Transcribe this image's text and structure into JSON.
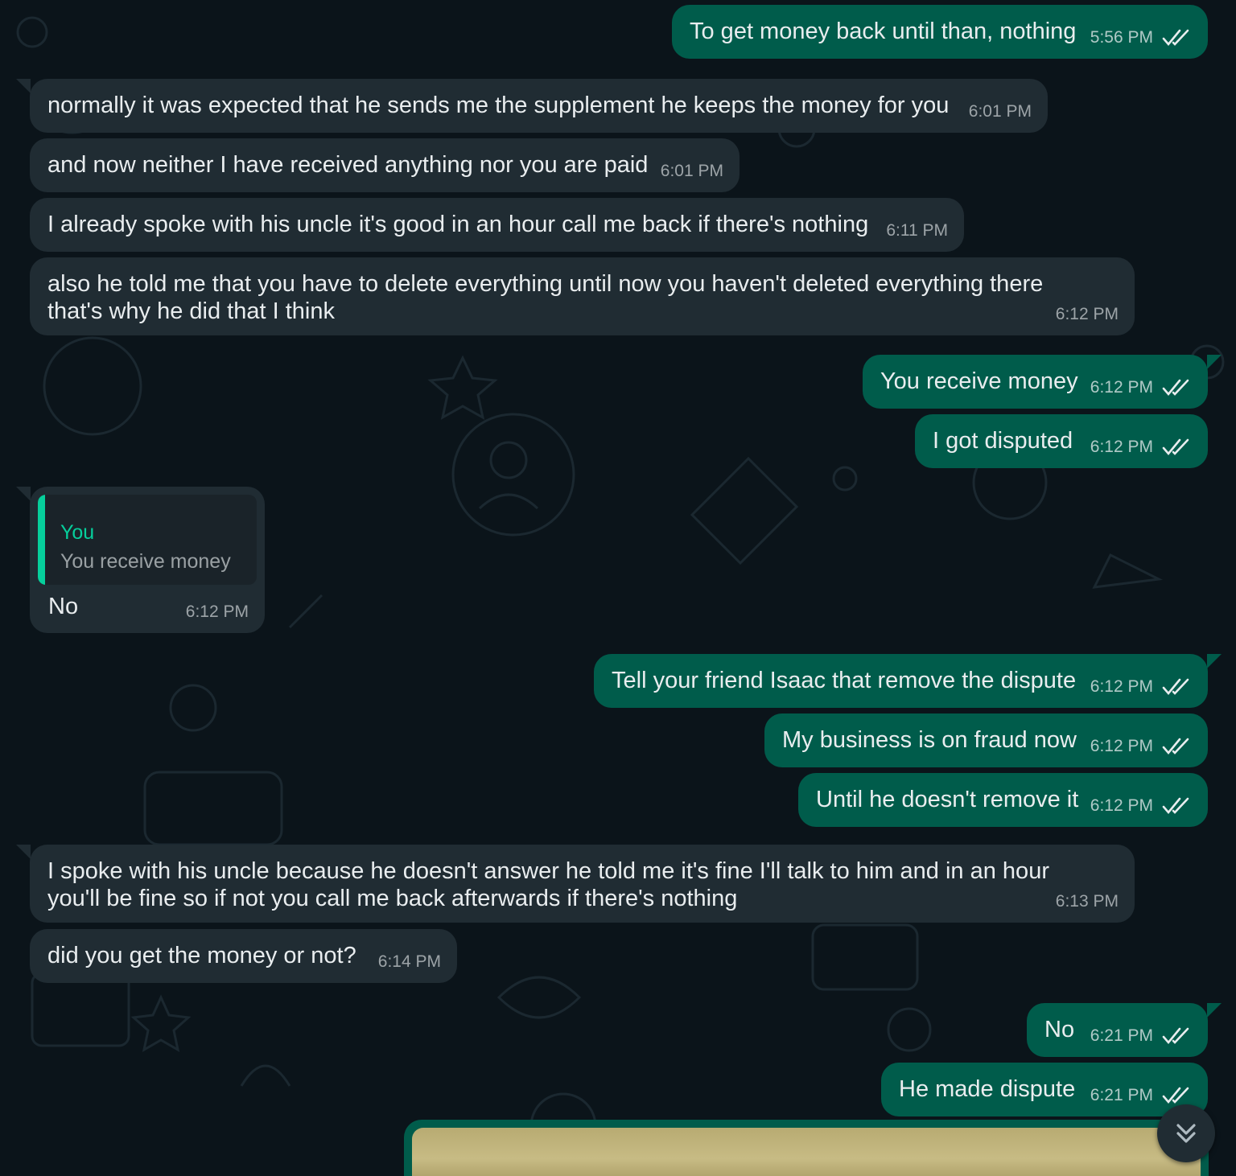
{
  "messages": [
    {
      "text": "To get money back until than, nothing",
      "time": "5:56 PM"
    },
    {
      "text": "normally it was expected that he sends me the supplement he keeps the money for you",
      "time": "6:01 PM"
    },
    {
      "text": "and now neither I have received anything nor you are paid",
      "time": "6:01 PM"
    },
    {
      "text": "I already spoke with his uncle it's good in an hour call me back if there's nothing",
      "time": "6:11 PM"
    },
    {
      "text": "also he told me that you have to delete everything until now you haven't deleted everything there that's why he did that I think",
      "time": "6:12 PM"
    },
    {
      "text": "You receive money",
      "time": "6:12 PM"
    },
    {
      "text": "I got disputed",
      "time": "6:12 PM"
    },
    {
      "quote_author": "You",
      "quote_text": "You receive money",
      "text": "No",
      "time": "6:12 PM"
    },
    {
      "text": "Tell your friend Isaac that remove the dispute",
      "time": "6:12 PM"
    },
    {
      "text": "My business is on fraud now",
      "time": "6:12 PM"
    },
    {
      "text": "Until he doesn't remove it",
      "time": "6:12 PM"
    },
    {
      "text": "I spoke with his uncle because he doesn't answer he told me it's fine I'll talk to him and in an hour you'll be fine so if not you call me back afterwards if there's nothing",
      "time": "6:13 PM"
    },
    {
      "text": "did you get the money or not?",
      "time": "6:14 PM"
    },
    {
      "text": "No",
      "time": "6:21 PM"
    },
    {
      "text": "He made dispute",
      "time": "6:21 PM"
    }
  ],
  "icons": {
    "read_receipt": "double-check-icon",
    "scroll_down": "chevrons-down-icon"
  },
  "colors": {
    "background": "#0b141a",
    "incoming_bubble": "#202c33",
    "outgoing_bubble": "#005c4b",
    "read_ticks": "#e9edef",
    "quote_accent": "#06cf9c"
  }
}
